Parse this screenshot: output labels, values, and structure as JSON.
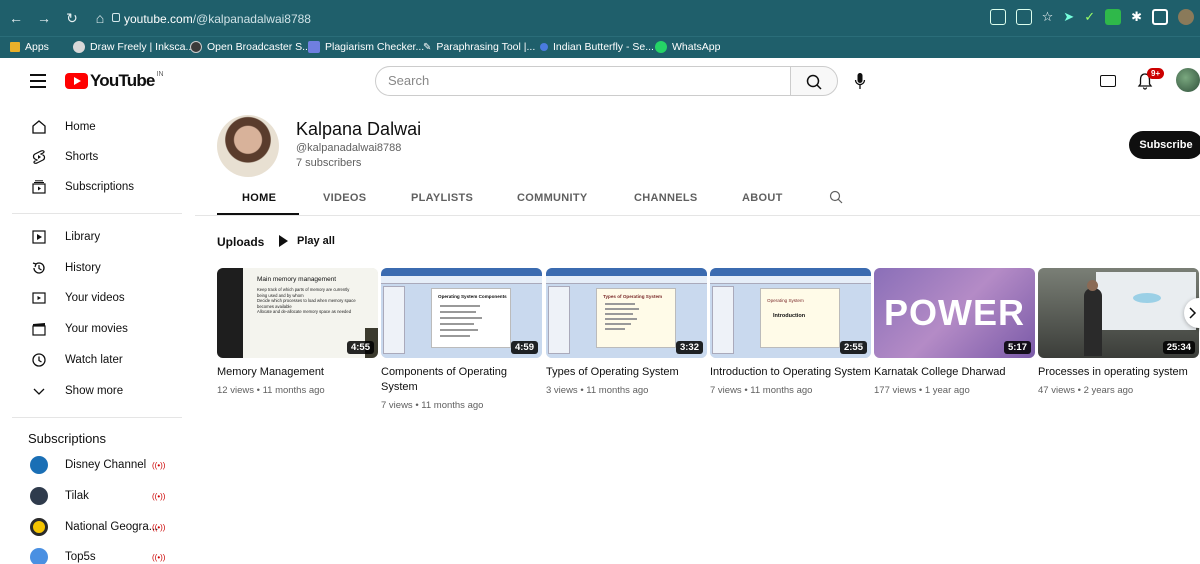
{
  "browser": {
    "url_host": "youtube.com",
    "url_path": "/@kalpanadalwai8788",
    "bookmarks": [
      {
        "label": "Apps",
        "color": "#e8b02a"
      },
      {
        "label": "Draw Freely | Inksca...",
        "color": "#d8d8d8"
      },
      {
        "label": "Open Broadcaster S...",
        "color": "#3a3a3a"
      },
      {
        "label": "Plagiarism Checker...",
        "color": "#6f7fe0"
      },
      {
        "label": "Paraphrasing Tool |...",
        "color": "#ffffff"
      },
      {
        "label": "Indian Butterfly - Se...",
        "color": "#4a7be0"
      },
      {
        "label": "WhatsApp",
        "color": "#25d366"
      }
    ]
  },
  "header": {
    "logo_text": "YouTube",
    "country": "IN",
    "search_placeholder": "Search",
    "notif_count": "9+"
  },
  "sidebar": {
    "main": [
      {
        "label": "Home",
        "icon": "home-icon"
      },
      {
        "label": "Shorts",
        "icon": "shorts-icon"
      },
      {
        "label": "Subscriptions",
        "icon": "subscriptions-icon"
      }
    ],
    "library": [
      {
        "label": "Library",
        "icon": "library-icon"
      },
      {
        "label": "History",
        "icon": "history-icon"
      },
      {
        "label": "Your videos",
        "icon": "your-videos-icon"
      },
      {
        "label": "Your movies",
        "icon": "movies-icon"
      },
      {
        "label": "Watch later",
        "icon": "clock-icon"
      },
      {
        "label": "Show more",
        "icon": "chevron-down-icon"
      }
    ],
    "subscriptions_heading": "Subscriptions",
    "subscriptions": [
      {
        "label": "Disney Channel",
        "color": "#1a6fb5",
        "live": "((•))"
      },
      {
        "label": "Tilak",
        "color": "#2f3b4c",
        "live": "((•))"
      },
      {
        "label": "National Geogra...",
        "color": "#f5c400",
        "live": "((•))"
      },
      {
        "label": "Top5s",
        "color": "#4a90e2",
        "live": "((•))"
      }
    ]
  },
  "channel": {
    "name": "Kalpana Dalwai",
    "handle": "@kalpanadalwai8788",
    "subscribers": "7 subscribers",
    "subscribe_label": "Subscribe",
    "tabs": [
      "HOME",
      "VIDEOS",
      "PLAYLISTS",
      "COMMUNITY",
      "CHANNELS",
      "ABOUT"
    ],
    "active_tab": "HOME"
  },
  "uploads": {
    "heading": "Uploads",
    "play_all": "Play all",
    "videos": [
      {
        "title": "Memory Management",
        "meta": "12 views • 11 months ago",
        "duration": "4:55",
        "thumb_heading": "Main memory management",
        "thumb_bullets": [
          "Keep track of which parts of memory are currently being used and by whom",
          "Decide which processes to load when memory space becomes available",
          "Allocate and de-allocate memory space as needed"
        ]
      },
      {
        "title": "Components of Operating System",
        "meta": "7 views • 11 months ago",
        "duration": "4:59",
        "thumb_heading": "Operating System Components"
      },
      {
        "title": "Types of Operating System",
        "meta": "3 views • 11 months ago",
        "duration": "3:32",
        "thumb_heading": "Types of Operating System"
      },
      {
        "title": "Introduction to Operating System",
        "meta": "7 views • 11 months ago",
        "duration": "2:55",
        "thumb_heading": "Operating System",
        "thumb_sub": "Introduction"
      },
      {
        "title": "Karnatak College Dharwad",
        "meta": "177 views • 1 year ago",
        "duration": "5:17",
        "thumb_heading": "POWER"
      },
      {
        "title": "Processes in operating system",
        "meta": "47 views • 2 years ago",
        "duration": "25:34"
      }
    ]
  }
}
